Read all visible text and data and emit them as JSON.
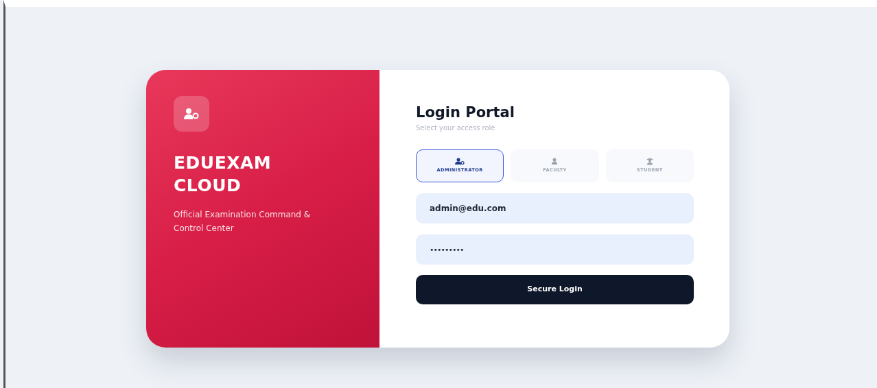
{
  "brand": {
    "title": "EDUEXAM CLOUD",
    "tagline": "Official Examination Command & Control Center"
  },
  "login": {
    "title": "Login Portal",
    "subtitle": "Select your access role"
  },
  "roles": [
    {
      "label": "ADMINISTRATOR",
      "kind": "admin",
      "selected": true
    },
    {
      "label": "FACULTY",
      "kind": "faculty",
      "selected": false
    },
    {
      "label": "STUDENT",
      "kind": "student",
      "selected": false
    }
  ],
  "fields": [
    {
      "kind": "email",
      "value": "admin@edu.com"
    },
    {
      "kind": "password",
      "value": "•••••••••"
    }
  ],
  "submit": {
    "label": "Secure Login"
  }
}
